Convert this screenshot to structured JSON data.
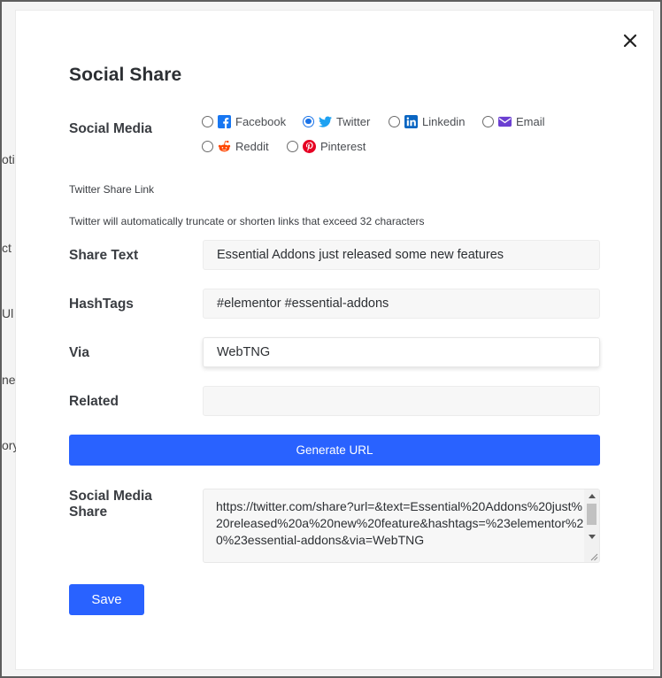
{
  "background": {
    "fragments": [
      "oti",
      "ct",
      "Ul",
      "ne",
      "ory"
    ]
  },
  "modal": {
    "title": "Social Share",
    "close_icon": "close-icon"
  },
  "social_media": {
    "label": "Social Media",
    "selected": "Twitter",
    "options": [
      {
        "label": "Facebook",
        "icon": "facebook-icon",
        "color": "#1877f2",
        "checked": false
      },
      {
        "label": "Twitter",
        "icon": "twitter-icon",
        "color": "#1da1f2",
        "checked": true
      },
      {
        "label": "Linkedin",
        "icon": "linkedin-icon",
        "color": "#0a66c2",
        "checked": false
      },
      {
        "label": "Email",
        "icon": "email-icon",
        "color": "#6b3fd1",
        "checked": false
      },
      {
        "label": "Reddit",
        "icon": "reddit-icon",
        "color": "#ff4500",
        "checked": false
      },
      {
        "label": "Pinterest",
        "icon": "pinterest-icon",
        "color": "#e60023",
        "checked": false
      }
    ]
  },
  "share_link": {
    "heading": "Twitter Share Link",
    "note": "Twitter will automatically truncate or shorten links that exceed 32 characters"
  },
  "fields": {
    "share_text": {
      "label": "Share Text",
      "value": "Essential Addons just released some new features"
    },
    "hashtags": {
      "label": "HashTags",
      "value": "#elementor #essential-addons"
    },
    "via": {
      "label": "Via",
      "value": "WebTNG"
    },
    "related": {
      "label": "Related",
      "value": ""
    }
  },
  "generate_button": {
    "label": "Generate URL",
    "color": "#2962ff"
  },
  "output": {
    "label_line1": "Social Media",
    "label_line2": "Share",
    "value": "https://twitter.com/share?url=&text=Essential%20Addons%20just%20released%20a%20new%20feature&hashtags=%23elementor%20%23essential-addons&via=WebTNG"
  },
  "save_button": {
    "label": "Save",
    "color": "#2962ff"
  }
}
